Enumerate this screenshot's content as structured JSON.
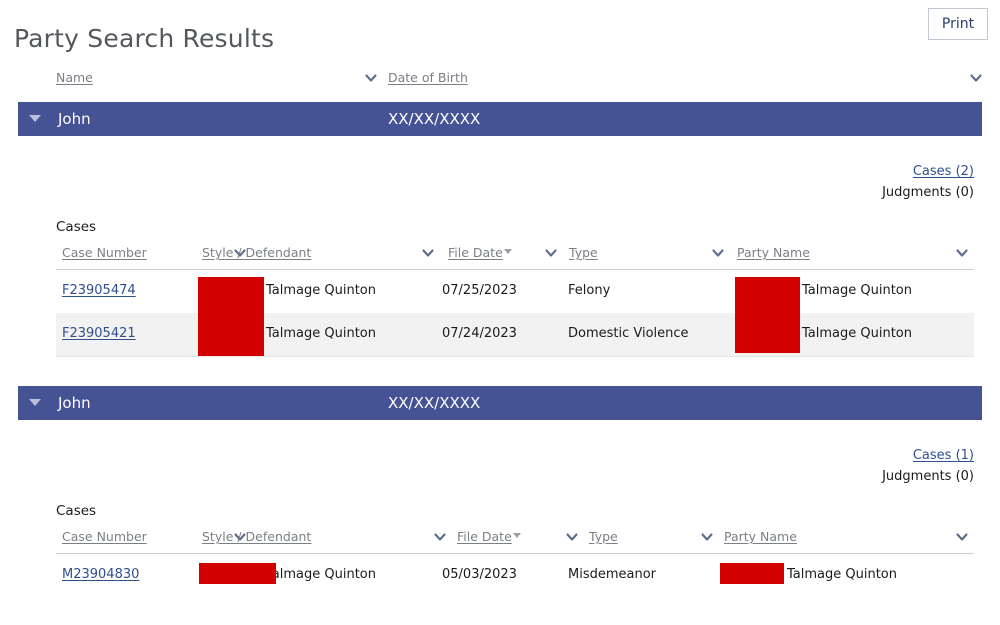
{
  "header": {
    "title": "Party Search Results",
    "print_label": "Print"
  },
  "outer_columns": [
    {
      "label": "Name",
      "icon": "chevron-down-icon"
    },
    {
      "label": "Date of Birth",
      "icon": "chevron-down-icon"
    }
  ],
  "case_columns": [
    {
      "label": "Case Number",
      "icon": "chevron-down-icon"
    },
    {
      "label": "Style / Defendant",
      "icon": "chevron-down-icon"
    },
    {
      "label": "File Date",
      "icon": "chevron-down-icon",
      "sorted": "descending"
    },
    {
      "label": "Type",
      "icon": "chevron-down-icon"
    },
    {
      "label": "Party Name",
      "icon": "chevron-down-icon"
    }
  ],
  "cases_section_label": "Cases",
  "parties": [
    {
      "name": "John",
      "date_of_birth": "XX/XX/XXXX",
      "expander_icon": "triangle-down-icon",
      "cases_link": "Cases (2)",
      "judgments_text": "Judgments (0)",
      "rows": [
        {
          "case_number": "F23905474",
          "style_defendant": "Talmage Quinton",
          "file_date": "07/25/2023",
          "type": "Felony",
          "party_name": "Talmage Quinton"
        },
        {
          "case_number": "F23905421",
          "style_defendant": "Talmage Quinton",
          "file_date": "07/24/2023",
          "type": "Domestic Violence",
          "party_name": "Talmage Quinton"
        }
      ]
    },
    {
      "name": "John",
      "date_of_birth": "XX/XX/XXXX",
      "expander_icon": "triangle-down-icon",
      "cases_link": "Cases (1)",
      "judgments_text": "Judgments (0)",
      "rows": [
        {
          "case_number": "M23904830",
          "style_defendant": "Talmage Quinton",
          "file_date": "05/03/2023",
          "type": "Misdemeanor",
          "party_name": "Talmage Quinton"
        }
      ]
    }
  ],
  "colors": {
    "header_bar": "#455395",
    "redaction": "#d20000",
    "link": "#2f4f8f",
    "alt_row": "#f2f2f2"
  }
}
